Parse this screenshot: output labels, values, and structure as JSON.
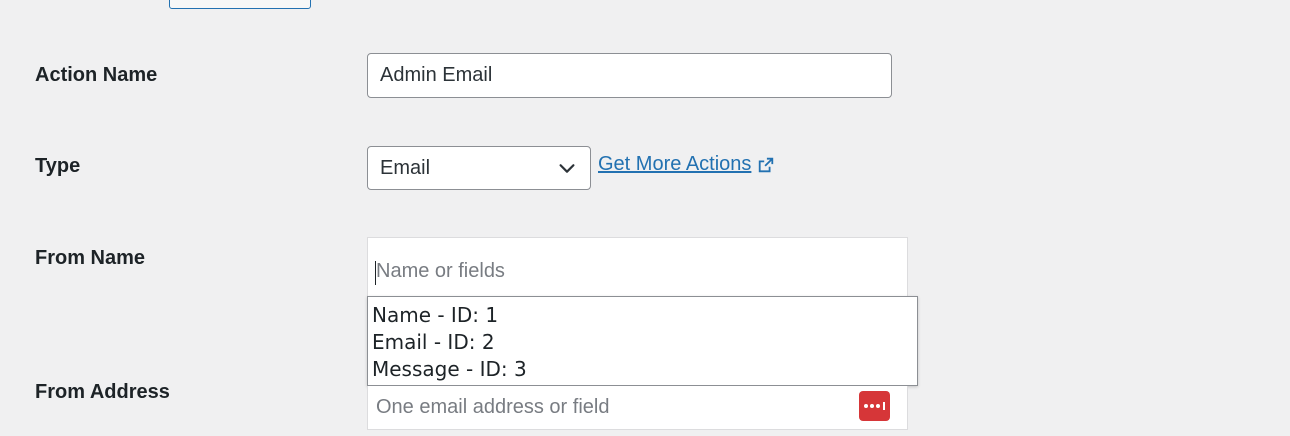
{
  "form": {
    "action_name": {
      "label": "Action Name",
      "value": "Admin Email"
    },
    "type": {
      "label": "Type",
      "selected": "Email",
      "more_link": "Get More Actions"
    },
    "from_name": {
      "label": "From Name",
      "placeholder": "Name or fields",
      "suggestions": [
        "Name - ID: 1",
        "Email - ID: 2",
        "Message - ID: 3"
      ]
    },
    "from_address": {
      "label": "From Address",
      "placeholder": "One email address or field"
    }
  },
  "colors": {
    "link": "#2271b1",
    "field_button": "#d63638"
  },
  "icons": {
    "select_arrow": "chevron-down-icon",
    "external": "external-link-icon",
    "field_picker": "ellipsis-icon"
  }
}
